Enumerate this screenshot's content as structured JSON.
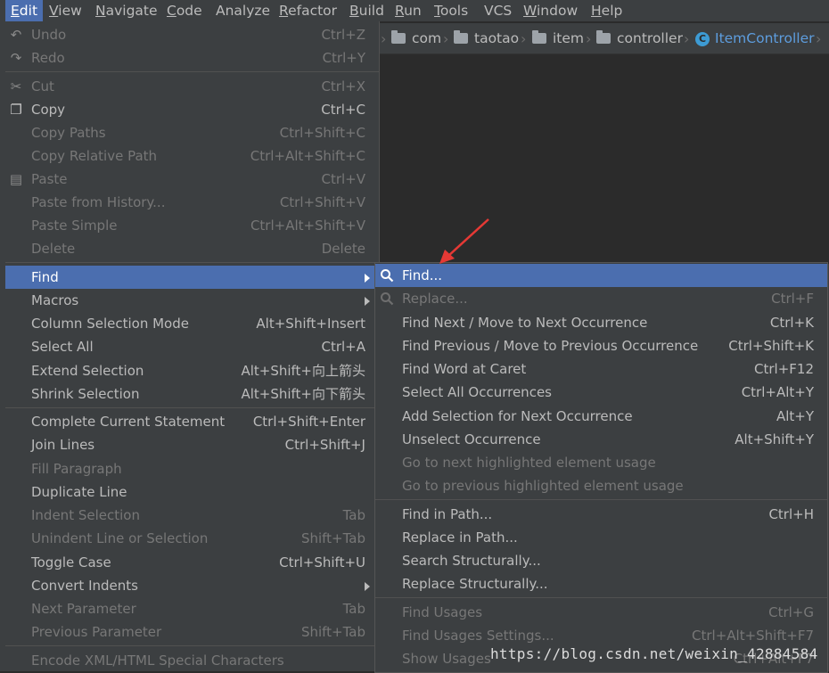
{
  "menubar": {
    "items": [
      {
        "label": "Edit",
        "mnemonic": "E",
        "rest": "dit"
      },
      {
        "label": "View",
        "mnemonic": "V",
        "rest": "iew"
      },
      {
        "label": "Navigate",
        "mnemonic": "N",
        "rest": "avigate"
      },
      {
        "label": "Code",
        "mnemonic": "C",
        "rest": "ode"
      },
      {
        "label": "Analyze",
        "mnemonic": "",
        "rest": "Analyze"
      },
      {
        "label": "Refactor",
        "mnemonic": "R",
        "rest": "efactor"
      },
      {
        "label": "Build",
        "mnemonic": "B",
        "rest": "uild"
      },
      {
        "label": "Run",
        "mnemonic": "R",
        "rest": "un"
      },
      {
        "label": "Tools",
        "mnemonic": "T",
        "rest": "ools"
      },
      {
        "label": "VCS",
        "mnemonic": "",
        "rest": "VCS"
      },
      {
        "label": "Window",
        "mnemonic": "W",
        "rest": "indow"
      },
      {
        "label": "Help",
        "mnemonic": "H",
        "rest": "elp"
      }
    ]
  },
  "breadcrumb": {
    "items": [
      "com",
      "taotao",
      "item",
      "controller",
      "ItemController"
    ]
  },
  "edit_menu": {
    "items": [
      {
        "label": "Undo",
        "shortcut": "Ctrl+Z",
        "disabled": true,
        "icon": "undo-icon"
      },
      {
        "label": "Redo",
        "shortcut": "Ctrl+Y",
        "disabled": true,
        "icon": "redo-icon"
      },
      {
        "label": "Cut",
        "shortcut": "Ctrl+X",
        "disabled": true,
        "icon": "scissors-icon"
      },
      {
        "label": "Copy",
        "shortcut": "Ctrl+C",
        "disabled": false,
        "icon": "copy-icon"
      },
      {
        "label": "Copy Paths",
        "shortcut": "Ctrl+Shift+C",
        "disabled": true
      },
      {
        "label": "Copy Relative Path",
        "shortcut": "Ctrl+Alt+Shift+C",
        "disabled": true
      },
      {
        "label": "Paste",
        "shortcut": "Ctrl+V",
        "disabled": true,
        "icon": "paste-icon"
      },
      {
        "label": "Paste from History...",
        "shortcut": "Ctrl+Shift+V",
        "disabled": true
      },
      {
        "label": "Paste Simple",
        "shortcut": "Ctrl+Alt+Shift+V",
        "disabled": true
      },
      {
        "label": "Delete",
        "shortcut": "Delete",
        "disabled": true
      },
      {
        "label": "Find",
        "shortcut": "",
        "disabled": false,
        "selected": true,
        "submenu": true
      },
      {
        "label": "Macros",
        "shortcut": "",
        "disabled": false,
        "submenu": true
      },
      {
        "label": "Column Selection Mode",
        "shortcut": "Alt+Shift+Insert",
        "disabled": false
      },
      {
        "label": "Select All",
        "shortcut": "Ctrl+A",
        "disabled": false
      },
      {
        "label": "Extend Selection",
        "shortcut": "Alt+Shift+向上箭头",
        "disabled": false
      },
      {
        "label": "Shrink Selection",
        "shortcut": "Alt+Shift+向下箭头",
        "disabled": false
      },
      {
        "label": "Complete Current Statement",
        "shortcut": "Ctrl+Shift+Enter",
        "disabled": false
      },
      {
        "label": "Join Lines",
        "shortcut": "Ctrl+Shift+J",
        "disabled": false
      },
      {
        "label": "Fill Paragraph",
        "shortcut": "",
        "disabled": true
      },
      {
        "label": "Duplicate Line",
        "shortcut": "",
        "disabled": false
      },
      {
        "label": "Indent Selection",
        "shortcut": "Tab",
        "disabled": true
      },
      {
        "label": "Unindent Line or Selection",
        "shortcut": "Shift+Tab",
        "disabled": true
      },
      {
        "label": "Toggle Case",
        "shortcut": "Ctrl+Shift+U",
        "disabled": false
      },
      {
        "label": "Convert Indents",
        "shortcut": "",
        "disabled": false,
        "submenu": true
      },
      {
        "label": "Next Parameter",
        "shortcut": "Tab",
        "disabled": true
      },
      {
        "label": "Previous Parameter",
        "shortcut": "Shift+Tab",
        "disabled": true
      },
      {
        "label": "Encode XML/HTML Special Characters",
        "shortcut": "",
        "disabled": true
      }
    ]
  },
  "find_submenu": {
    "items": [
      {
        "label": "Find...",
        "shortcut": "",
        "disabled": false,
        "selected": true,
        "icon": "search-icon"
      },
      {
        "label": "Replace...",
        "shortcut": "Ctrl+F",
        "disabled": true,
        "icon": "replace-icon"
      },
      {
        "label": "Find Next / Move to Next Occurrence",
        "shortcut": "Ctrl+K",
        "disabled": false
      },
      {
        "label": "Find Previous / Move to Previous Occurrence",
        "shortcut": "Ctrl+Shift+K",
        "disabled": false
      },
      {
        "label": "Find Word at Caret",
        "shortcut": "Ctrl+F12",
        "disabled": false
      },
      {
        "label": "Select All Occurrences",
        "shortcut": "Ctrl+Alt+Y",
        "disabled": false
      },
      {
        "label": "Add Selection for Next Occurrence",
        "shortcut": "Alt+Y",
        "disabled": false
      },
      {
        "label": "Unselect Occurrence",
        "shortcut": "Alt+Shift+Y",
        "disabled": false
      },
      {
        "label": "Go to next highlighted element usage",
        "shortcut": "",
        "disabled": true
      },
      {
        "label": "Go to previous highlighted element usage",
        "shortcut": "",
        "disabled": true
      },
      {
        "label": "Find in Path...",
        "shortcut": "Ctrl+H",
        "disabled": false
      },
      {
        "label": "Replace in Path...",
        "shortcut": "",
        "disabled": false
      },
      {
        "label": "Search Structurally...",
        "shortcut": "",
        "disabled": false
      },
      {
        "label": "Replace Structurally...",
        "shortcut": "",
        "disabled": false
      },
      {
        "label": "Find Usages",
        "shortcut": "Ctrl+G",
        "disabled": true
      },
      {
        "label": "Find Usages Settings...",
        "shortcut": "Ctrl+Alt+Shift+F7",
        "disabled": true
      },
      {
        "label": "Show Usages",
        "shortcut": "Ctrl+Alt+F7",
        "disabled": true
      }
    ]
  },
  "watermark": "https://blog.csdn.net/weixin_42884584",
  "colors": {
    "selection": "#4b6eaf",
    "menu_bg": "#3c3f41",
    "editor_bg": "#2b2b2b",
    "class_link": "#5d9dde",
    "annotation_arrow": "#e53935"
  }
}
